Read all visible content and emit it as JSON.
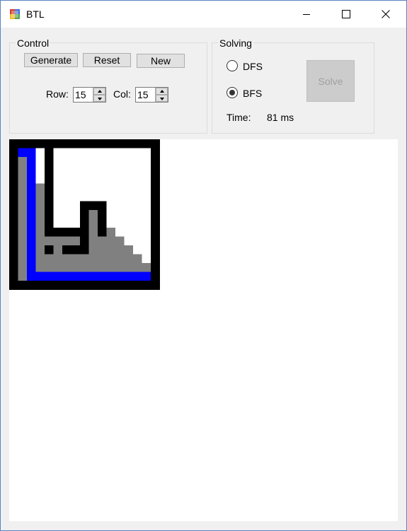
{
  "window": {
    "title": "BTL"
  },
  "control": {
    "title": "Control",
    "generate_label": "Generate",
    "reset_label": "Reset",
    "new_label": "New",
    "row_label": "Row:",
    "row_value": "15",
    "col_label": "Col:",
    "col_value": "15"
  },
  "solving": {
    "title": "Solving",
    "dfs_label": "DFS",
    "bfs_label": "BFS",
    "selected": "BFS",
    "solve_label": "Solve",
    "time_label": "Time:",
    "time_value": "81 ms"
  },
  "colors": {
    "wall": "#000000",
    "path": "#0000ff",
    "visited": "#808080",
    "open": "#ffffff"
  },
  "maze": {
    "rows": 17,
    "cols": 17,
    "cells": [
      "WWWWWWWWWWWWWWWWW",
      "WBBOWOOOOOOOOOOOW",
      "WGBOWOOOOOOOOOOOW",
      "WGBOWOOOOOOOOOOOW",
      "WGBOWOOOOOOOOOOOW",
      "WGBGWOOOOOOOOOOOW",
      "WGBGWOOOOOOOOOOOW",
      "WGBGWOOOWWWOOOOOW",
      "WGBGWOOOWGWOOOOOW",
      "WGBGWOOOWGWOOOOOW",
      "WGBGWWWWWGWGOOOOW",
      "WGBGGGGGWGGGGOOOW",
      "WGBGWGWWWGGGGGOOW",
      "WGBGGGGGGGGGGGGOW",
      "WGBGGGGGGGGGGGGGW",
      "WGBBBBBBBBBBBBBBW",
      "WWWWWWWWWWWWWWWWW"
    ]
  }
}
